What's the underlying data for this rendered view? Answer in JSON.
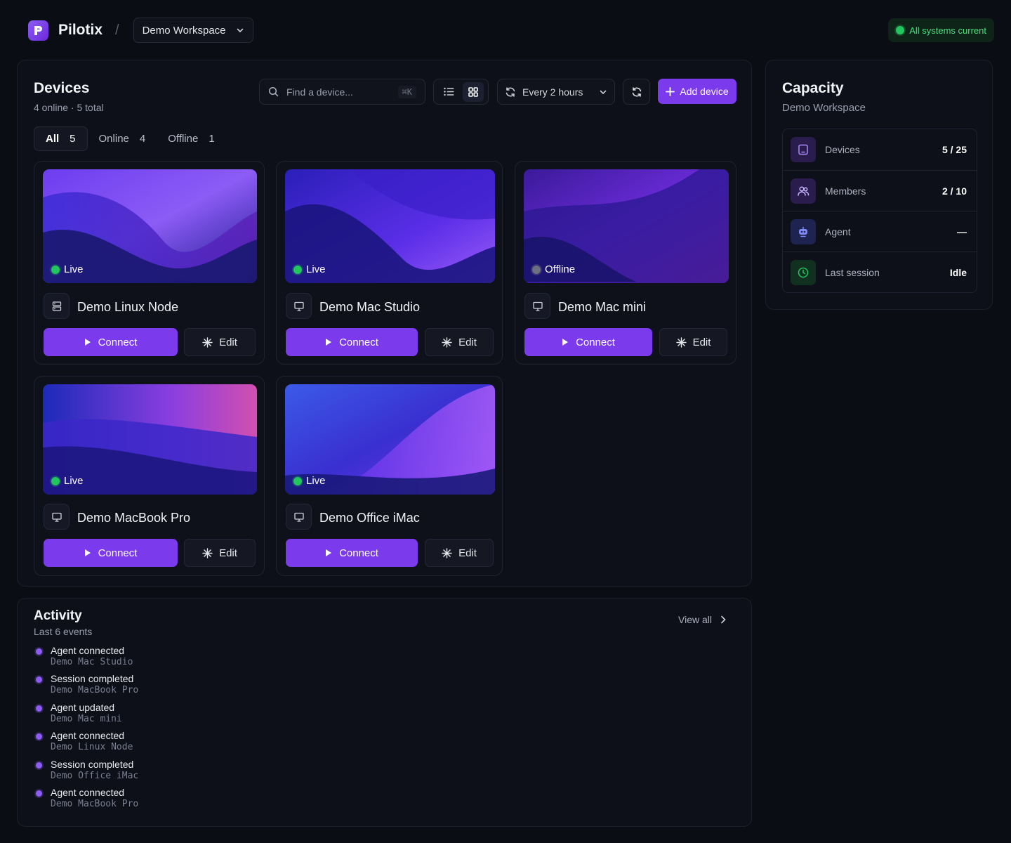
{
  "app": {
    "brand": "Pilotix",
    "workspace": "Demo Workspace",
    "system_status": "All systems current"
  },
  "devices": {
    "title": "Devices",
    "summary": "4 online · 5 total",
    "search_placeholder": "Find a device...",
    "search_shortcut": "⌘K",
    "interval": "Every 2 hours",
    "add_label": "Add device",
    "tabs": [
      {
        "label": "All",
        "count": "5"
      },
      {
        "label": "Online",
        "count": "4"
      },
      {
        "label": "Offline",
        "count": "1"
      }
    ],
    "connect_label": "Connect",
    "edit_label": "Edit",
    "items": [
      {
        "name": "Demo Linux Node",
        "status": "Live",
        "online": true,
        "icon": "server-icon"
      },
      {
        "name": "Demo Mac Studio",
        "status": "Live",
        "online": true,
        "icon": "monitor-icon"
      },
      {
        "name": "Demo Mac mini",
        "status": "Offline",
        "online": false,
        "icon": "monitor-icon"
      },
      {
        "name": "Demo MacBook Pro",
        "status": "Live",
        "online": true,
        "icon": "monitor-icon"
      },
      {
        "name": "Demo Office iMac",
        "status": "Live",
        "online": true,
        "icon": "monitor-icon"
      }
    ]
  },
  "capacity": {
    "title": "Capacity",
    "subtitle": "Demo Workspace",
    "rows": [
      {
        "label": "Devices",
        "value": "5 / 25",
        "icon": "tablet-icon",
        "color": "#8b5cf6"
      },
      {
        "label": "Members",
        "value": "2 / 10",
        "icon": "users-icon",
        "color": "#a78bfa"
      },
      {
        "label": "Agent",
        "value": "—",
        "icon": "robot-icon",
        "color": "#818cf8"
      },
      {
        "label": "Last session",
        "value": "Idle",
        "icon": "clock-icon",
        "color": "#22c55e"
      }
    ]
  },
  "activity": {
    "title": "Activity",
    "subtitle": "Last 6 events",
    "view_all": "View all",
    "events": [
      {
        "title": "Agent connected",
        "device": "Demo Mac Studio"
      },
      {
        "title": "Session completed",
        "device": "Demo MacBook Pro"
      },
      {
        "title": "Agent updated",
        "device": "Demo Mac mini"
      },
      {
        "title": "Agent connected",
        "device": "Demo Linux Node"
      },
      {
        "title": "Session completed",
        "device": "Demo Office iMac"
      },
      {
        "title": "Agent connected",
        "device": "Demo MacBook Pro"
      }
    ]
  },
  "colors": {
    "accent": "#7c3aed",
    "live": "#22c55e",
    "offline": "#6b7080",
    "background": "#0b0d14"
  }
}
